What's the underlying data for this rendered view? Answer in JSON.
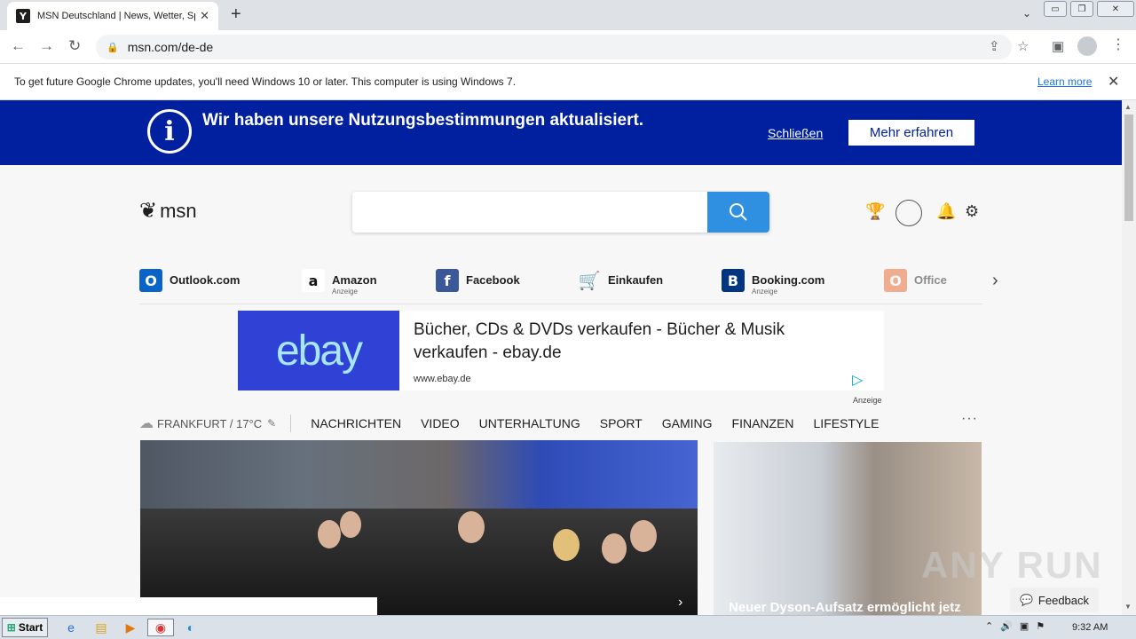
{
  "browser": {
    "tab_title": "MSN Deutschland | News, Wetter, Sport",
    "tab_favicon": "msn-favicon",
    "new_tab": "+",
    "url": "msn.com/de-de"
  },
  "infobar": {
    "message": "To get future Google Chrome updates, you'll need Windows 10 or later. This computer is using Windows 7.",
    "learn_more": "Learn more"
  },
  "terms_banner": {
    "headline": "Wir haben unsere Nutzungsbestimmungen aktualisiert.",
    "close": "Schließen",
    "more": "Mehr erfahren",
    "color": "#00209f"
  },
  "header": {
    "logo": "msn",
    "search_placeholder": ""
  },
  "quicklinks": [
    {
      "label": "Outlook.com",
      "sub": "",
      "icon": "outlook-icon",
      "color": "#0a64c8"
    },
    {
      "label": "Amazon",
      "sub": "Anzeige",
      "icon": "amazon-icon",
      "color": "#ffffff"
    },
    {
      "label": "Facebook",
      "sub": "",
      "icon": "facebook-icon",
      "color": "#3b5998"
    },
    {
      "label": "Einkaufen",
      "sub": "",
      "icon": "shopping-cart-icon",
      "color": "#0078d4"
    },
    {
      "label": "Booking.com",
      "sub": "Anzeige",
      "icon": "booking-icon",
      "color": "#003580"
    },
    {
      "label": "Office",
      "sub": "",
      "icon": "office-icon",
      "color": "#e8632a"
    }
  ],
  "ad": {
    "logo": "ebay",
    "title": "Bücher, CDs & DVDs verkaufen - Bücher & Musik verkaufen - ebay.de",
    "url": "www.ebay.de",
    "label": "Anzeige"
  },
  "nav": {
    "weather": "FRANKFURT / 17°C",
    "categories": [
      "NACHRICHTEN",
      "VIDEO",
      "UNTERHALTUNG",
      "SPORT",
      "GAMING",
      "FINANZEN",
      "LIFESTYLE"
    ],
    "more": "···"
  },
  "cards": {
    "side_headline": "Neuer Dyson-Aufsatz ermöglicht jetz"
  },
  "feedback": "Feedback",
  "watermark": "ANY RUN",
  "taskbar": {
    "start": "Start",
    "clock": "9:32 AM"
  }
}
